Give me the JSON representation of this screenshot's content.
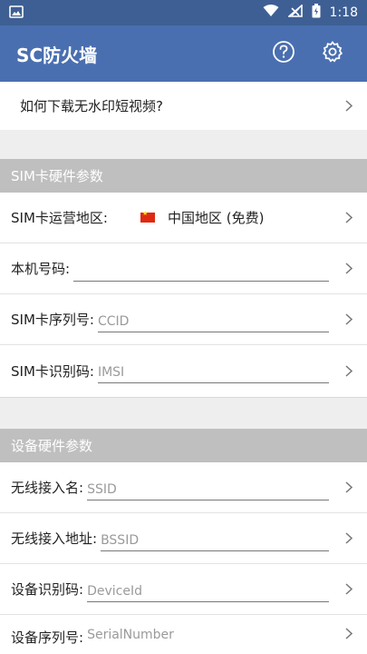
{
  "status_bar": {
    "time": "1:18",
    "icons": [
      "image-icon",
      "wifi-icon",
      "signal-icon",
      "battery-charging-icon"
    ]
  },
  "app_bar": {
    "title": "SC防火墙",
    "icons": [
      "help-icon",
      "settings-icon"
    ]
  },
  "top_item": {
    "label": "如何下载无水印短视频?"
  },
  "sim_section": {
    "header": "SIM卡硬件参数",
    "carrier_label": "SIM卡运营地区:",
    "carrier_value": "中国地区 (免费)",
    "phone_label": "本机号码:",
    "phone_value": "",
    "ccid_label": "SIM卡序列号:",
    "ccid_placeholder": "CCID",
    "imsi_label": "SIM卡识别码:",
    "imsi_placeholder": "IMSI"
  },
  "device_section": {
    "header": "设备硬件参数",
    "ssid_label": "无线接入名:",
    "ssid_placeholder": "SSID",
    "bssid_label": "无线接入地址:",
    "bssid_placeholder": "BSSID",
    "deviceid_label": "设备识别码:",
    "deviceid_placeholder": "DeviceId",
    "serial_label": "设备序列号:",
    "serial_placeholder": "SerialNumber"
  },
  "colors": {
    "app_bar": "#4a6fb0",
    "status_bar": "#3e5f94",
    "section_header": "#bfbfbf"
  }
}
